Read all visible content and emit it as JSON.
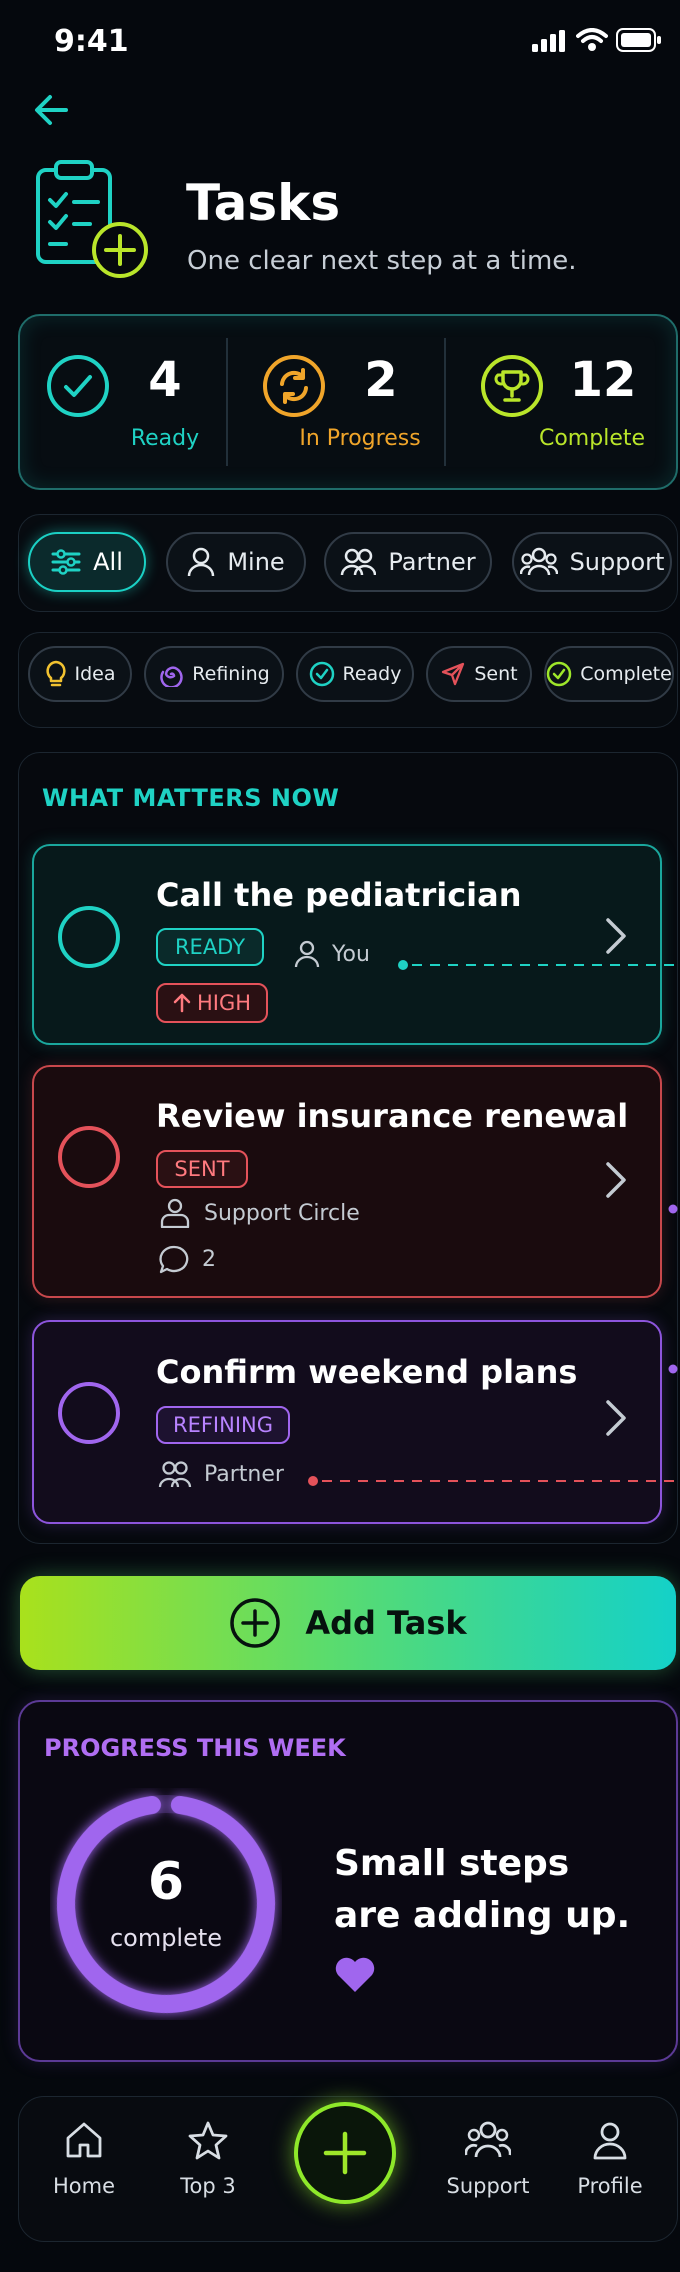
{
  "status_bar": {
    "time": "9:41"
  },
  "header": {
    "title": "Tasks",
    "subtitle": "One clear next step at a time."
  },
  "stats": [
    {
      "value": "4",
      "label": "Ready",
      "color": "#1fd2c4"
    },
    {
      "value": "2",
      "label": "In Progress",
      "color": "#f0a52a"
    },
    {
      "value": "12",
      "label": "Complete",
      "color": "#b9e52a"
    }
  ],
  "filters": {
    "owner": [
      {
        "label": "All",
        "active": true
      },
      {
        "label": "Mine",
        "active": false
      },
      {
        "label": "Partner",
        "active": false
      },
      {
        "label": "Support",
        "active": false
      }
    ],
    "stage": [
      {
        "label": "Idea"
      },
      {
        "label": "Refining"
      },
      {
        "label": "Ready"
      },
      {
        "label": "Sent"
      },
      {
        "label": "Complete"
      }
    ]
  },
  "section": {
    "title": "WHAT MATTERS NOW",
    "tasks": [
      {
        "title": "Call the pediatrician",
        "status": "READY",
        "priority": "HIGH",
        "assignee": "You",
        "color": "#1fd2c4"
      },
      {
        "title": "Review insurance renewal",
        "status": "SENT",
        "assignee": "Support Circle",
        "comments": "2",
        "color": "#e4525a"
      },
      {
        "title": "Confirm weekend plans",
        "status": "REFINING",
        "assignee": "Partner",
        "color": "#a066ee"
      }
    ]
  },
  "add_task": {
    "label": "Add Task"
  },
  "progress": {
    "title": "PROGRESS THIS WEEK",
    "count": "6",
    "count_label": "complete",
    "message": "Small steps are adding up."
  },
  "bottom_nav": [
    {
      "label": "Home"
    },
    {
      "label": "Top 3"
    },
    {
      "label": "Support"
    },
    {
      "label": "Profile"
    }
  ],
  "colors": {
    "teal": "#1fd2c4",
    "red": "#e4525a",
    "purple": "#a066ee",
    "lime": "#9ee62a",
    "orange": "#f0a52a"
  }
}
